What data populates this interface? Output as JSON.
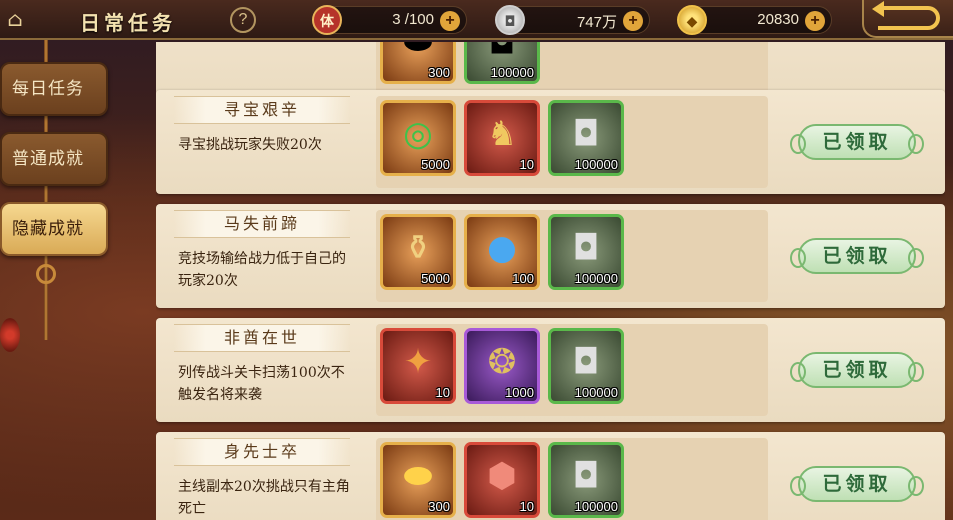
{
  "header": {
    "title": "日常任务",
    "help_label": "?",
    "stamina": {
      "icon_label": "体",
      "value": "3 /100"
    },
    "coins": {
      "value": "747万"
    },
    "gold": {
      "value": "20830"
    },
    "plus_label": "+"
  },
  "tabs": [
    {
      "label": "每日任务",
      "active": false
    },
    {
      "label": "普通成就",
      "active": false
    },
    {
      "label": "隐藏成就",
      "active": true
    }
  ],
  "partial_card": {
    "rewards": [
      {
        "qty": "300"
      },
      {
        "qty": "100000"
      }
    ]
  },
  "tasks": [
    {
      "name": "寻宝艰辛",
      "desc": "寻宝挑战玩家失败20次",
      "status": "已领取",
      "rewards": [
        {
          "icon": "jade-icon",
          "rarity": "orange",
          "qty": "5000"
        },
        {
          "icon": "golden-beast-icon",
          "rarity": "red",
          "qty": "10"
        },
        {
          "icon": "silver-coin-icon",
          "rarity": "green",
          "qty": "100000"
        }
      ]
    },
    {
      "name": "马失前蹄",
      "desc": "竞技场输给战力低于自己的玩家20次",
      "status": "已领取",
      "rewards": [
        {
          "icon": "scroll-icon",
          "rarity": "orange",
          "qty": "5000"
        },
        {
          "icon": "blue-orb-icon",
          "rarity": "orange",
          "qty": "100"
        },
        {
          "icon": "silver-coin-icon",
          "rarity": "green",
          "qty": "100000"
        }
      ]
    },
    {
      "name": "非酋在世",
      "desc": "列传战斗关卡扫荡100次不触发名将来袭",
      "status": "已领取",
      "rewards": [
        {
          "icon": "talisman-icon",
          "rarity": "red",
          "qty": "10"
        },
        {
          "icon": "purple-talisman-icon",
          "rarity": "purple",
          "qty": "1000"
        },
        {
          "icon": "silver-coin-icon",
          "rarity": "green",
          "qty": "100000"
        }
      ]
    },
    {
      "name": "身先士卒",
      "desc": "主线副本20次挑战只有主角死亡",
      "status": "已领取",
      "rewards": [
        {
          "icon": "gold-ingot-icon",
          "rarity": "orange",
          "qty": "300"
        },
        {
          "icon": "red-gem-icon",
          "rarity": "red",
          "qty": "10"
        },
        {
          "icon": "silver-coin-icon",
          "rarity": "green",
          "qty": "100000"
        }
      ]
    }
  ]
}
